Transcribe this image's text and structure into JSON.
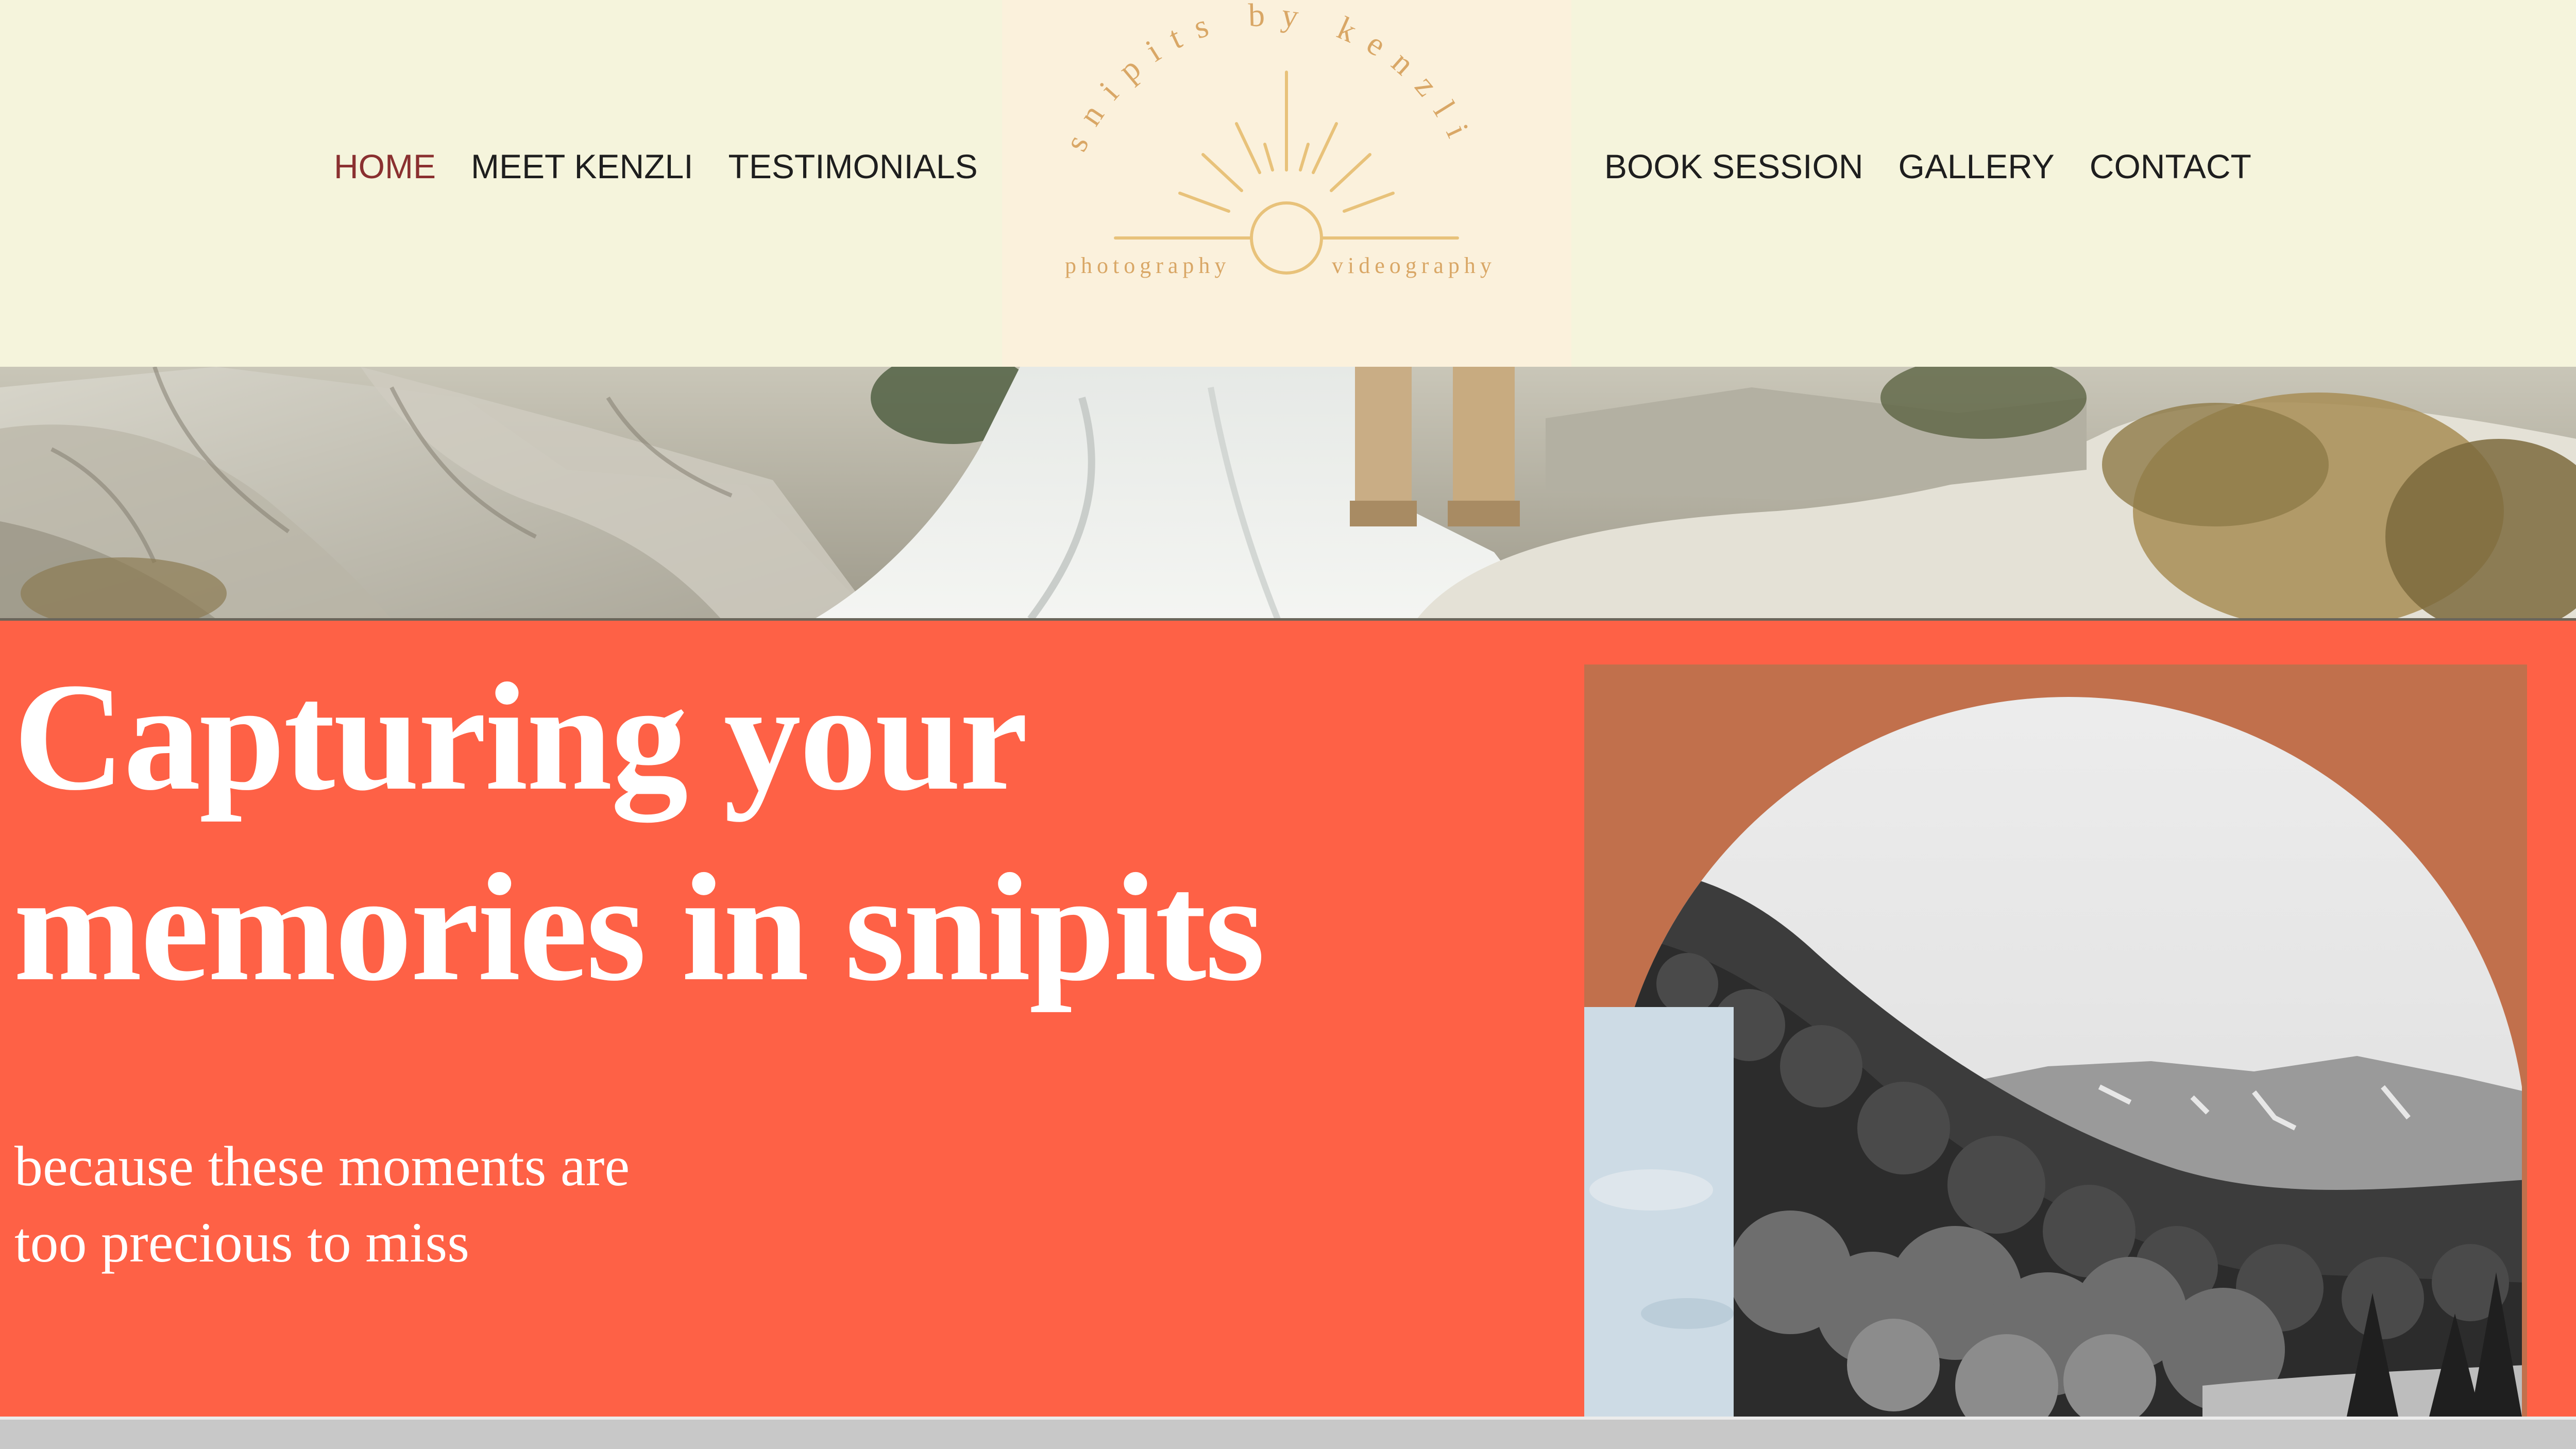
{
  "nav": {
    "left": [
      {
        "label": "HOME",
        "active": true
      },
      {
        "label": "MEET KENZLI",
        "active": false
      },
      {
        "label": "TESTIMONIALS",
        "active": false
      }
    ],
    "right": [
      {
        "label": "BOOK SESSION",
        "active": false
      },
      {
        "label": "GALLERY",
        "active": false
      },
      {
        "label": "CONTACT",
        "active": false
      }
    ]
  },
  "logo": {
    "arc_text": "snipits by kenzli",
    "left_caption": "photography",
    "right_caption": "videography",
    "icon": "sun-rays-icon"
  },
  "hero": {
    "headline_line1": "Capturing your",
    "headline_line2": "memories in snipits",
    "subline_line1": "because these moments are",
    "subline_line2": "too precious to miss"
  },
  "colors": {
    "header_bg": "#f5f4dc",
    "logo_bg": "#fbf1dc",
    "logo_gold": "#e8c27a",
    "active_nav": "#8a3030",
    "hero_bg": "#fe6146",
    "art_frame": "#c1704c"
  }
}
